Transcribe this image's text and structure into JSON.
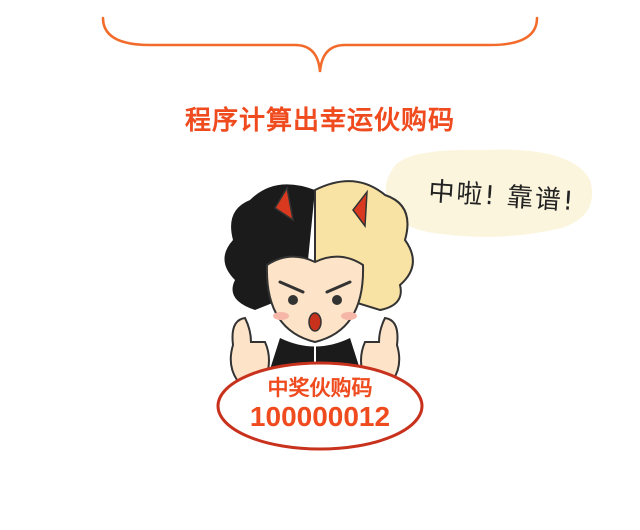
{
  "heading": "程序计算出幸运伙购码",
  "speech_bubble": "中啦! 靠谱!",
  "badge": {
    "title": "中奖伙购码",
    "number": "100000012"
  },
  "colors": {
    "accent": "#ef4b1f",
    "bubble_fill": "#fbf5dd",
    "hair_light": "#f9e3a4",
    "hair_dark": "#1b1b1b",
    "horn": "#d93a1f",
    "skin": "#fde3c7"
  }
}
